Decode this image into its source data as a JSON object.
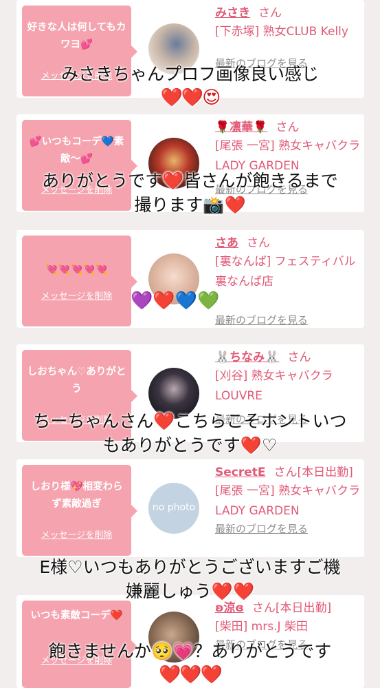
{
  "cards": [
    {
      "message": "好きな人は何してもカワヨ💕",
      "delete_label": "メッセージを削除",
      "name": "みさき",
      "san": "さん",
      "shop": "[下赤塚] 熟女CLUB Kelly",
      "blog": "最新のブログを見る"
    },
    {
      "message": "💕いつもコーデ💙素敵〜💕",
      "delete_label": "メッセージを削除",
      "name": "🌹凛華🌹",
      "san": "さん",
      "shop": "[尾張 一宮] 熟女キャバクラ LADY GARDEN",
      "blog": "最新のブログを見る"
    },
    {
      "message": "💘💘💘💘💘",
      "delete_label": "メッセージを削除",
      "name": "さあ",
      "san": "さん",
      "shop": "[裏なんば] フェスティバル 裏なんば店",
      "blog": "最新のブログを見る"
    },
    {
      "message": "しおちゃん♡ありがとう",
      "delete_label": "メッセージを削除",
      "name": "🐰ちなみ🐰",
      "san": "さん",
      "shop": "[刈谷] 熟女キャバクラ LOUVRE",
      "blog": "最新のブログを見る"
    },
    {
      "message": "しおり様💖相変わらず素敵過ぎ",
      "delete_label": "メッセージを削除",
      "name": "SecretE",
      "san": "さん[本日出勤]",
      "shop": "[尾張 一宮] 熟女キャバクラ LADY GARDEN",
      "blog": "最新のブログを見る",
      "avatar_text": "no photo"
    },
    {
      "message": "いつも素敵コーデ❤️",
      "delete_label": "メッセージを削除",
      "name": "ʚ涼ɞ",
      "san": "さん[本日出勤]",
      "shop": "[柴田] mrs.J 柴田",
      "blog": "最新のブログを見る"
    }
  ],
  "overlays": [
    {
      "line1": "みさきちゃんプロフ画像良い感じ",
      "line2": "❤️❤️😍"
    },
    {
      "line1": "ありがとうです❤️皆さんが飽きるまで",
      "line2": "撮ります📸❤️"
    },
    {
      "line1": "💜❤️💙💚"
    },
    {
      "line1": "ちーちゃんさん❤️こちらこそホントいつ",
      "line2": "もありがとうです❤️♡"
    },
    {
      "line1": "E様♡いつもありがとうございますご機",
      "line2": "嫌麗しゅう❤️❤️"
    },
    {
      "line1": "飽きませんか🥺💗？ありがとうです",
      "line2": "❤️❤️❤️"
    }
  ],
  "colors": {
    "bubble": "#f5a3ae",
    "accent": "#e05a76",
    "background": "#f3eeee"
  }
}
